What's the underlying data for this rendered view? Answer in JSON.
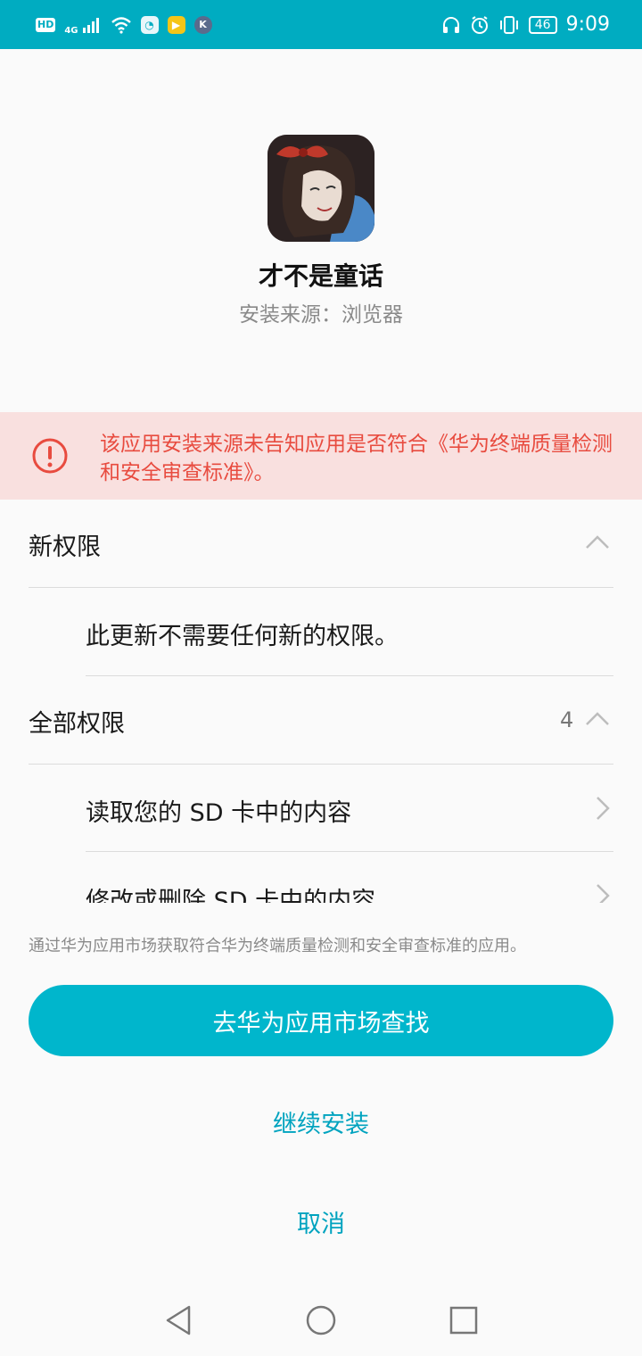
{
  "status_bar": {
    "left_badges": [
      "HD",
      "4G"
    ],
    "left_icons": [
      "signal-icon",
      "wifi-icon",
      "browser-app-icon",
      "video-app-icon",
      "k-app-icon"
    ],
    "right_icons": [
      "headset-icon",
      "alarm-icon",
      "vibrate-icon"
    ],
    "battery": "46",
    "time": "9:09"
  },
  "app": {
    "name": "才不是童话",
    "source": "安装来源：浏览器"
  },
  "warning": {
    "text": "该应用安装来源未告知应用是否符合《华为终端质量检测和安全审查标准》。",
    "color": "#e84b3f"
  },
  "new_permissions": {
    "title": "新权限",
    "message": "此更新不需要任何新的权限。"
  },
  "all_permissions": {
    "title": "全部权限",
    "count": "4",
    "items": [
      "读取您的 SD 卡中的内容",
      "修改或删除 SD 卡中的内容"
    ]
  },
  "footnote": "通过华为应用市场获取符合华为终端质量检测和安全审查标准的应用。",
  "buttons": {
    "primary": "去华为应用市场查找",
    "continue": "继续安装",
    "cancel": "取消"
  },
  "colors": {
    "status_bar": "#00acc1",
    "primary": "#00b6cc",
    "link": "#00a3bf"
  }
}
